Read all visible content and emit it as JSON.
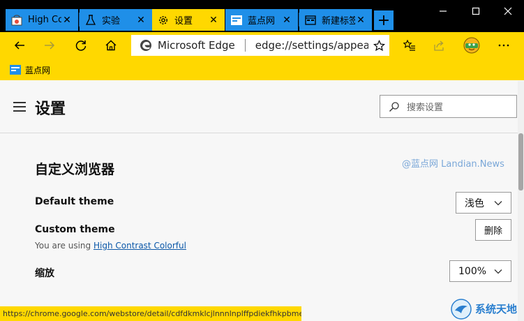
{
  "tabs": [
    {
      "title": "High Contrast Colorful",
      "icon": "webstore-icon",
      "active": false
    },
    {
      "title": "实验",
      "icon": "flask-icon",
      "active": false
    },
    {
      "title": "设置",
      "icon": "gear-icon",
      "active": true
    },
    {
      "title": "蓝点网",
      "icon": "landian-icon",
      "active": false
    },
    {
      "title": "新建标签页",
      "icon": "newtab-page-icon",
      "active": false
    }
  ],
  "toolbar": {
    "address_site": "Microsoft Edge",
    "address_url": "edge://settings/appearance"
  },
  "favorites": [
    {
      "label": "蓝点网",
      "icon": "landian-icon"
    }
  ],
  "header": {
    "title": "设置",
    "search_placeholder": "搜索设置"
  },
  "section": {
    "title": "自定义浏览器",
    "watermark": "@蓝点网 Landian.News",
    "default_theme_label": "Default theme",
    "default_theme_value": "浅色",
    "custom_theme_label": "Custom theme",
    "custom_theme_prefix": "You are using",
    "custom_theme_link": "High Contrast Colorful",
    "remove_label": "删除",
    "zoom_label": "缩放",
    "zoom_value": "100%"
  },
  "status_url": "https://chrome.google.com/webstore/detail/cdfdkmklcjlnnnlnplffpdiekfhkpbme",
  "brand": "系统天地",
  "colors": {
    "tab_blue": "#1f8fe8",
    "accent_yellow": "#ffd800",
    "link_blue": "#0a57a8"
  }
}
